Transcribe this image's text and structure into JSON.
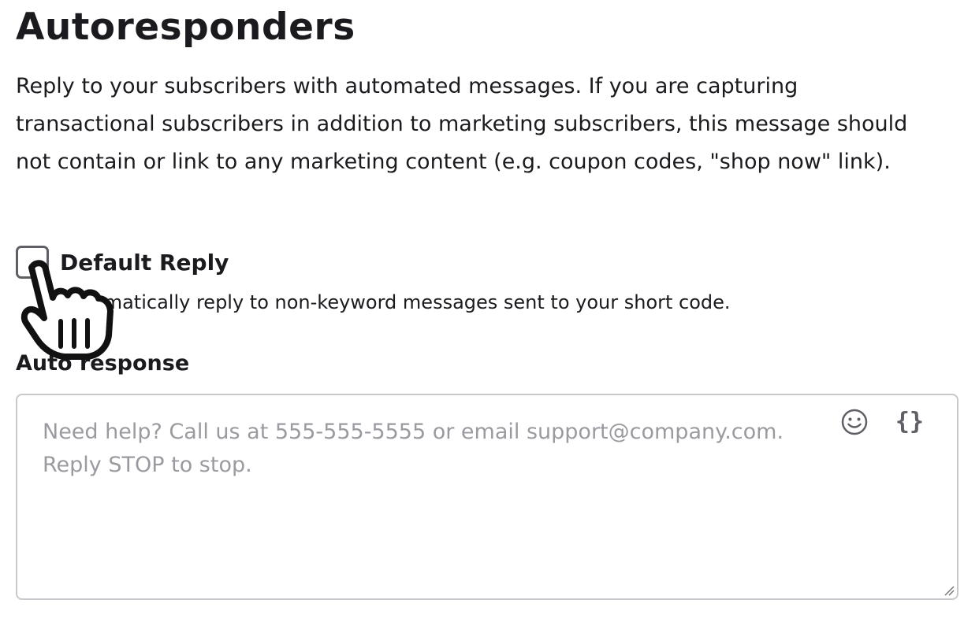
{
  "page": {
    "title": "Autoresponders",
    "description": "Reply to your subscribers with automated messages. If you are capturing transactional subscribers in addition to marketing subscribers, this message should not contain or link to any marketing content (e.g. coupon codes, \"shop now\" link)."
  },
  "default_reply": {
    "label": "Default Reply",
    "checked": false,
    "help": "Automatically reply to non-keyword messages sent to your short code."
  },
  "auto_response": {
    "label": "Auto response",
    "value": "",
    "placeholder": "Need help? Call us at 555-555-5555 or email support@company.com. Reply STOP to stop.",
    "emoji_icon": "smiley-face-icon",
    "variable_icon": "curly-braces-icon",
    "variable_glyph": "{}"
  },
  "colors": {
    "text": "#1b1b1f",
    "placeholder": "#9a9aa0",
    "border": "#c8c8cd",
    "icon": "#5f5f66"
  }
}
